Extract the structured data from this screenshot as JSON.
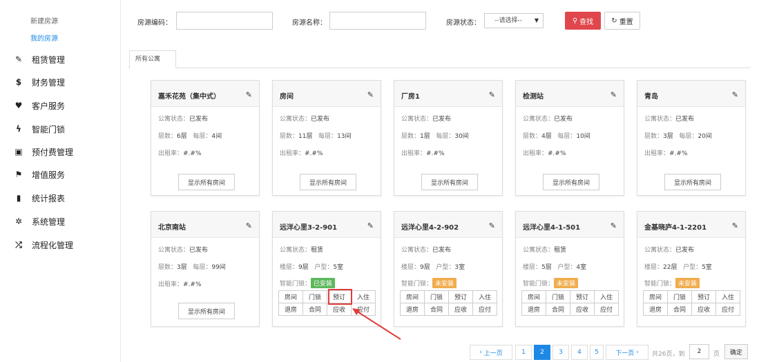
{
  "sidebar": {
    "sub_items": [
      "新建房源",
      "我的房源"
    ],
    "items": [
      {
        "label": "租赁管理",
        "icon": "edit-icon"
      },
      {
        "label": "财务管理",
        "icon": "dollar-icon"
      },
      {
        "label": "客户服务",
        "icon": "heart-icon"
      },
      {
        "label": "智能门锁",
        "icon": "bolt-icon"
      },
      {
        "label": "预付费管理",
        "icon": "wallet-icon"
      },
      {
        "label": "增值服务",
        "icon": "gift-icon"
      },
      {
        "label": "统计报表",
        "icon": "bar-chart-icon"
      },
      {
        "label": "系统管理",
        "icon": "gear-icon"
      },
      {
        "label": "流程化管理",
        "icon": "shuffle-icon"
      }
    ]
  },
  "search": {
    "code_label": "房源编码：",
    "name_label": "房源名称：",
    "status_label": "房源状态：",
    "status_value": "--请选择--",
    "search_button": "查找",
    "reset_button": "重置"
  },
  "tabs": [
    "所有公寓"
  ],
  "colors": {
    "installed": "#5cb85c",
    "not_installed": "#f0ad4e",
    "search": "#e0474c",
    "accent": "#1e88e5",
    "highlight": "#e03c3c"
  },
  "cards": [
    {
      "title": "嘉禾花苑（集中式）",
      "status_label": "公寓状态：",
      "status": "已发布",
      "floor_label": "层数：",
      "floors": "6层",
      "per_label": "每层：",
      "per": "4间",
      "rent_label": "出租率：",
      "rent": "#.#%",
      "show_button": "显示所有房间"
    },
    {
      "title": "房间",
      "status_label": "公寓状态：",
      "status": "已发布",
      "floor_label": "层数：",
      "floors": "11层",
      "per_label": "每层：",
      "per": "13间",
      "rent_label": "出租率：",
      "rent": "#.#%",
      "show_button": "显示所有房间"
    },
    {
      "title": "厂房1",
      "status_label": "公寓状态：",
      "status": "已发布",
      "floor_label": "层数：",
      "floors": "1层",
      "per_label": "每层：",
      "per": "30间",
      "rent_label": "出租率：",
      "rent": "#.#%",
      "show_button": "显示所有房间"
    },
    {
      "title": "检测站",
      "status_label": "公寓状态：",
      "status": "已发布",
      "floor_label": "层数：",
      "floors": "4层",
      "per_label": "每层：",
      "per": "10间",
      "rent_label": "出租率：",
      "rent": "#.#%",
      "show_button": "显示所有房间"
    },
    {
      "title": "青岛",
      "status_label": "公寓状态：",
      "status": "已发布",
      "floor_label": "层数：",
      "floors": "3层",
      "per_label": "每层：",
      "per": "20间",
      "rent_label": "出租率：",
      "rent": "#.#%",
      "show_button": "显示所有房间"
    },
    {
      "title": "北京南站",
      "status_label": "公寓状态：",
      "status": "已发布",
      "floor_label": "层数：",
      "floors": "3层",
      "per_label": "每层：",
      "per": "99间",
      "rent_label": "出租率：",
      "rent": "#.#%",
      "show_button": "显示所有房间"
    },
    {
      "title": "远洋心里3-2-901",
      "status_label": "公寓状态：",
      "status": "租赁",
      "floor_label": "楼层：",
      "floors": "9层",
      "per_label": "户型：",
      "per": "5室",
      "lock_label": "智能门锁：",
      "lock": "已安装",
      "ops": [
        "房间",
        "门锁",
        "预订",
        "入住",
        "退房",
        "合同",
        "应收",
        "应付"
      ]
    },
    {
      "title": "远洋心里4-2-902",
      "status_label": "公寓状态：",
      "status": "已发布",
      "floor_label": "楼层：",
      "floors": "9层",
      "per_label": "户型：",
      "per": "3室",
      "lock_label": "智能门锁：",
      "lock": "未安装",
      "ops": [
        "房间",
        "门锁",
        "预订",
        "入住",
        "退房",
        "合同",
        "应收",
        "应付"
      ]
    },
    {
      "title": "远洋心里4-1-501",
      "status_label": "公寓状态：",
      "status": "租赁",
      "floor_label": "楼层：",
      "floors": "5层",
      "per_label": "户型：",
      "per": "4室",
      "lock_label": "智能门锁：",
      "lock": "未安装",
      "ops": [
        "房间",
        "门锁",
        "预订",
        "入住",
        "退房",
        "合同",
        "应收",
        "应付"
      ]
    },
    {
      "title": "金基晓庐4-1-2201",
      "status_label": "公寓状态：",
      "status": "已发布",
      "floor_label": "楼层：",
      "floors": "22层",
      "per_label": "户型：",
      "per": "5室",
      "lock_label": "智能门锁：",
      "lock": "未安装",
      "ops": [
        "房间",
        "门锁",
        "预订",
        "入住",
        "退房",
        "合同",
        "应收",
        "应付"
      ]
    }
  ],
  "pagination": {
    "prev": "上一页",
    "pages": [
      "1",
      "2",
      "3",
      "4",
      "5"
    ],
    "current": "2",
    "next": "下一页",
    "total": "共26页，到",
    "page_input": "2",
    "page_unit": "页",
    "confirm": "确定"
  }
}
